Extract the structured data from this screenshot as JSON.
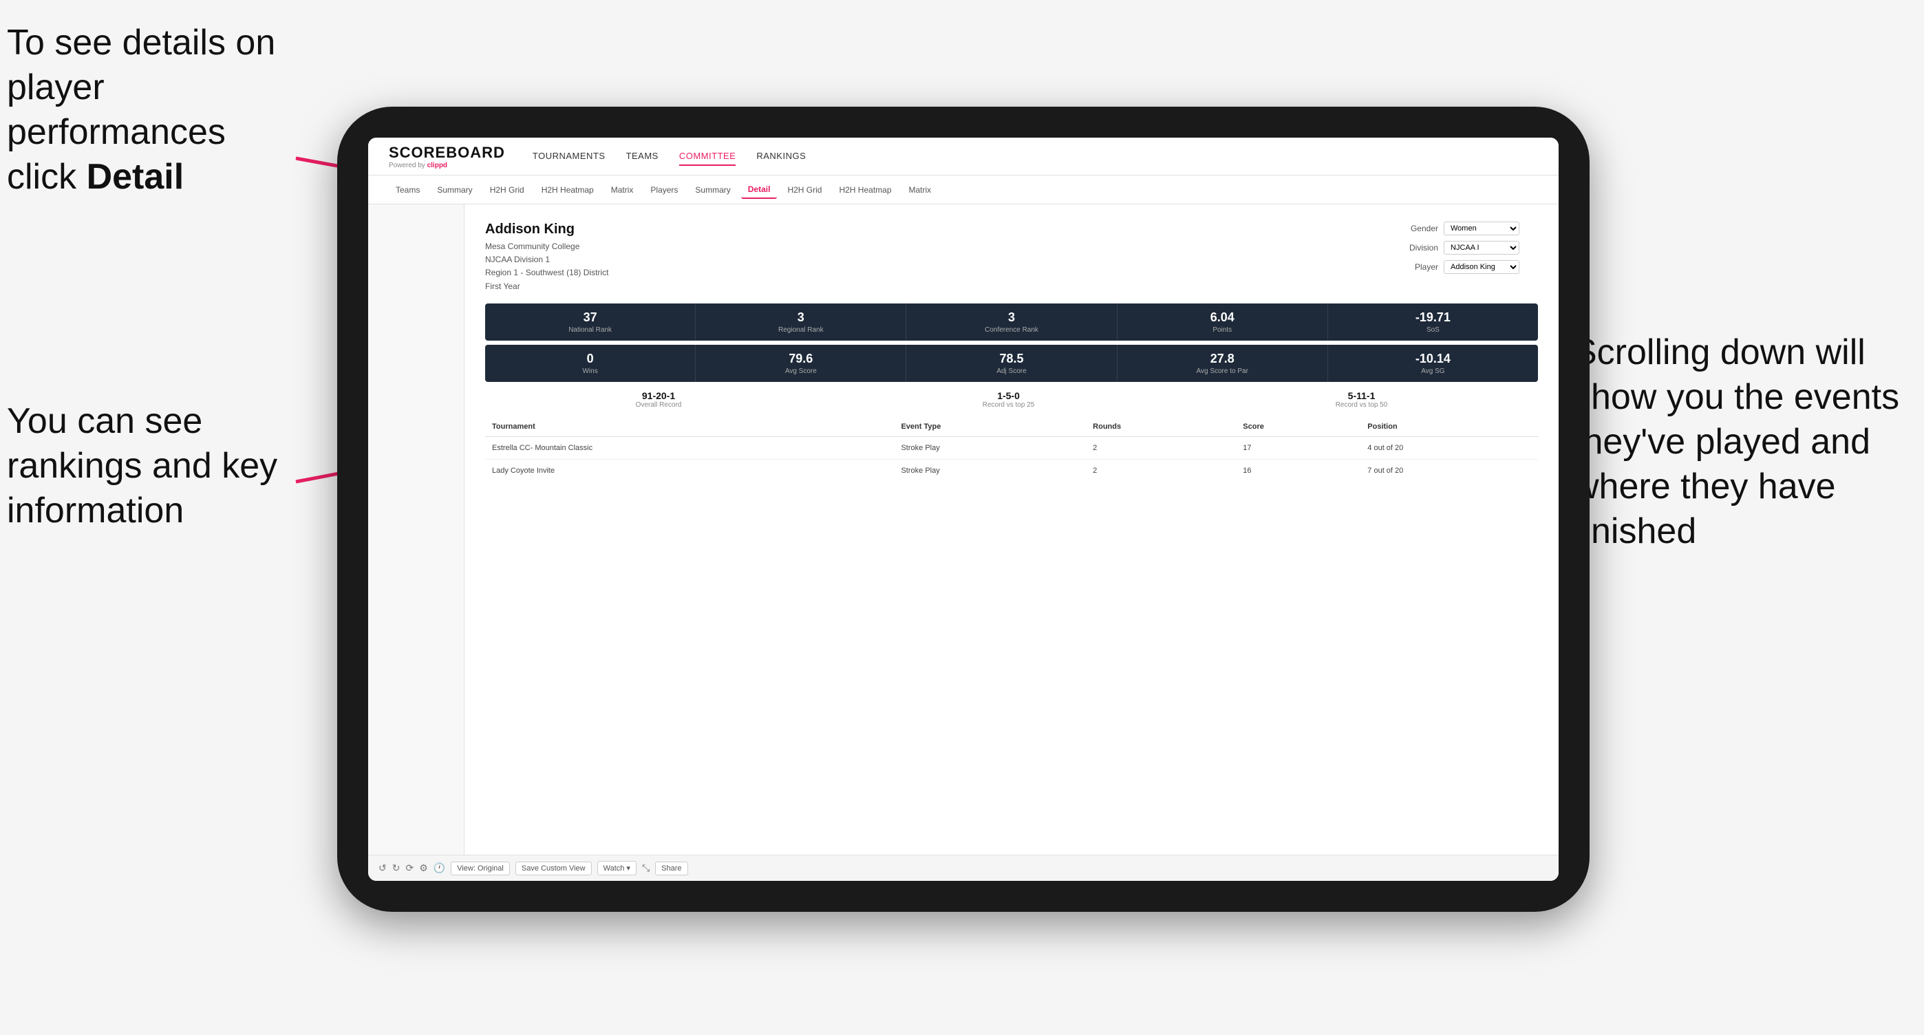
{
  "annotations": {
    "topleft": {
      "line1": "To see details on",
      "line2": "player performances",
      "line3": "click ",
      "line3bold": "Detail"
    },
    "bottomleft": {
      "line1": "You can see",
      "line2": "rankings and",
      "line3": "key information"
    },
    "bottomright": {
      "line1": "Scrolling down",
      "line2": "will show you",
      "line3": "the events",
      "line4": "they've played",
      "line5": "and where they",
      "line6": "have finished"
    }
  },
  "nav": {
    "logo": "SCOREBOARD",
    "powered_by": "Powered by clippd",
    "links": [
      {
        "label": "TOURNAMENTS",
        "active": false
      },
      {
        "label": "TEAMS",
        "active": false
      },
      {
        "label": "COMMITTEE",
        "active": true
      },
      {
        "label": "RANKINGS",
        "active": false
      }
    ]
  },
  "subnav": {
    "links": [
      {
        "label": "Teams",
        "active": false
      },
      {
        "label": "Summary",
        "active": false
      },
      {
        "label": "H2H Grid",
        "active": false
      },
      {
        "label": "H2H Heatmap",
        "active": false
      },
      {
        "label": "Matrix",
        "active": false
      },
      {
        "label": "Players",
        "active": false
      },
      {
        "label": "Summary",
        "active": false
      },
      {
        "label": "Detail",
        "active": true
      },
      {
        "label": "H2H Grid",
        "active": false
      },
      {
        "label": "H2H Heatmap",
        "active": false
      },
      {
        "label": "Matrix",
        "active": false
      }
    ]
  },
  "player": {
    "name": "Addison King",
    "college": "Mesa Community College",
    "division": "NJCAA Division 1",
    "region": "Region 1 - Southwest (18) District",
    "year": "First Year",
    "gender_label": "Gender",
    "gender_value": "Women",
    "division_label": "Division",
    "division_value": "NJCAA I",
    "player_label": "Player",
    "player_value": "Addison King"
  },
  "stats_row1": [
    {
      "value": "37",
      "label": "National Rank"
    },
    {
      "value": "3",
      "label": "Regional Rank"
    },
    {
      "value": "3",
      "label": "Conference Rank"
    },
    {
      "value": "6.04",
      "label": "Points"
    },
    {
      "value": "-19.71",
      "label": "SoS"
    }
  ],
  "stats_row2": [
    {
      "value": "0",
      "label": "Wins"
    },
    {
      "value": "79.6",
      "label": "Avg Score"
    },
    {
      "value": "78.5",
      "label": "Adj Score"
    },
    {
      "value": "27.8",
      "label": "Avg Score to Par"
    },
    {
      "value": "-10.14",
      "label": "Avg SG"
    }
  ],
  "records": [
    {
      "value": "91-20-1",
      "label": "Overall Record"
    },
    {
      "value": "1-5-0",
      "label": "Record vs top 25"
    },
    {
      "value": "5-11-1",
      "label": "Record vs top 50"
    }
  ],
  "table": {
    "headers": [
      "Tournament",
      "Event Type",
      "Rounds",
      "Score",
      "Position"
    ],
    "rows": [
      {
        "tournament": "Estrella CC- Mountain Classic",
        "event_type": "Stroke Play",
        "rounds": "2",
        "score": "17",
        "position": "4 out of 20"
      },
      {
        "tournament": "Lady Coyote Invite",
        "event_type": "Stroke Play",
        "rounds": "2",
        "score": "16",
        "position": "7 out of 20"
      }
    ]
  },
  "toolbar": {
    "buttons": [
      "View: Original",
      "Save Custom View",
      "Watch ▾",
      "Share"
    ]
  }
}
